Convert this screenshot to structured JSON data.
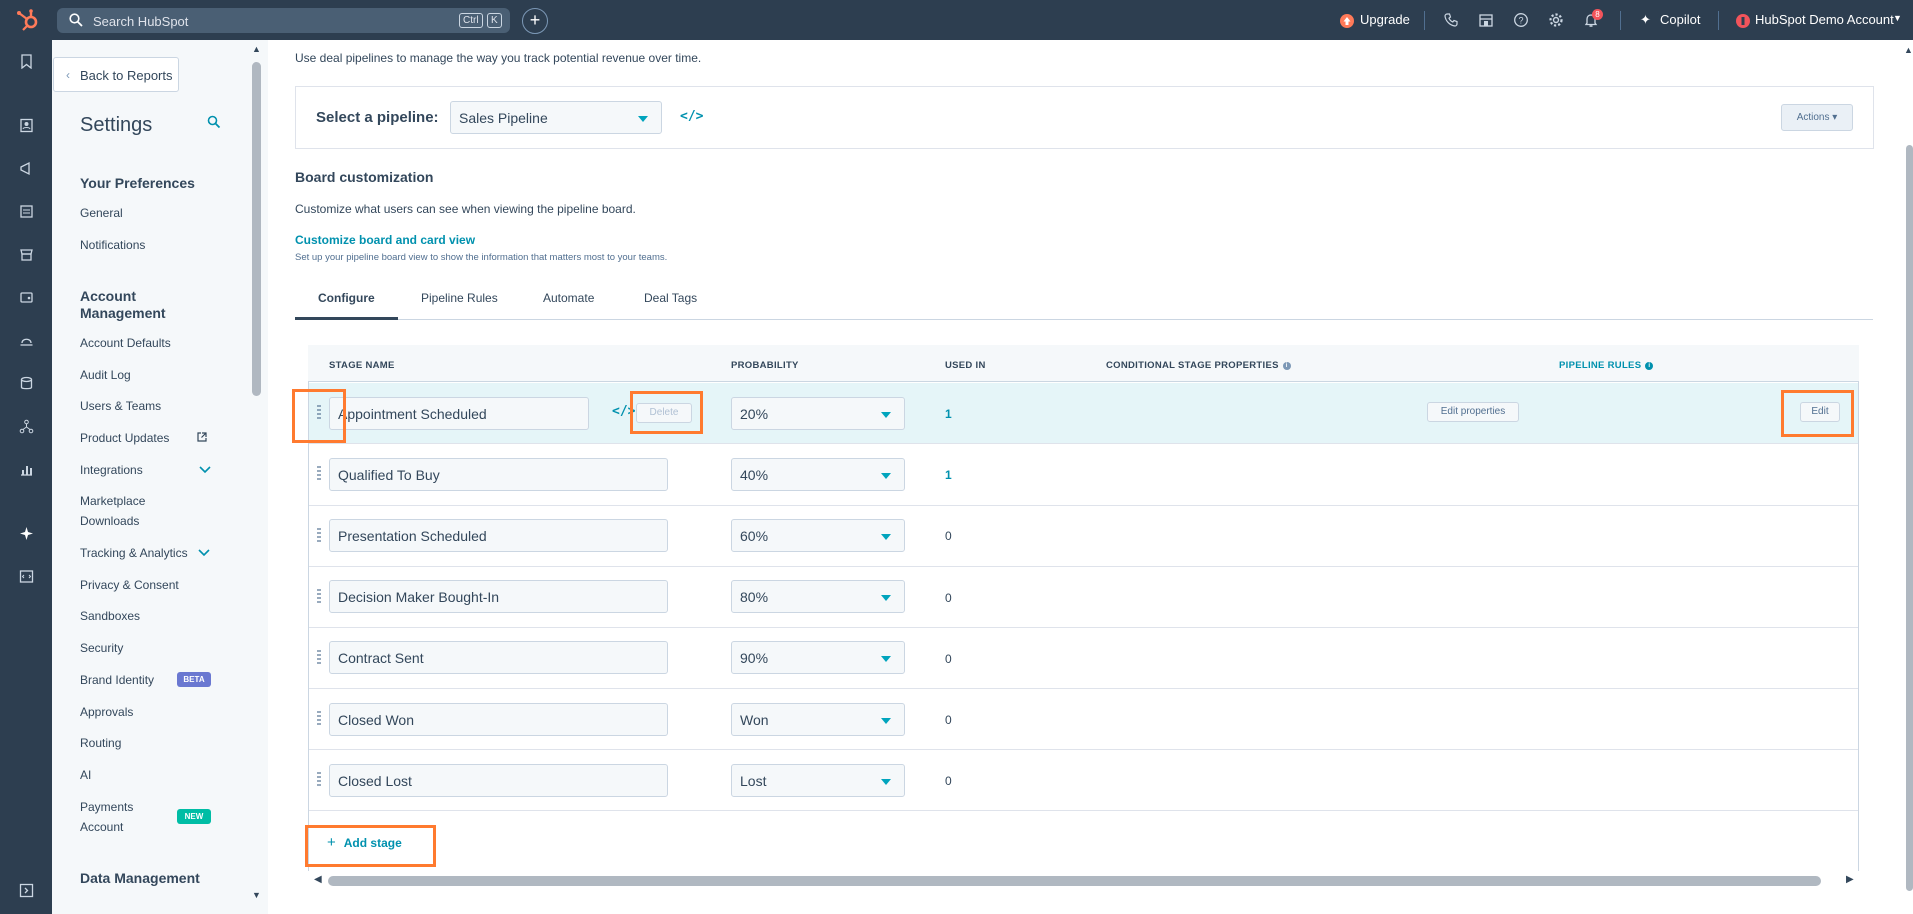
{
  "topbar": {
    "search_placeholder": "Search HubSpot",
    "shortcut_ctrl": "Ctrl",
    "shortcut_key": "K",
    "create_label": "+",
    "upgrade_label": "Upgrade",
    "copilot_label": "Copilot",
    "notification_count": "8",
    "account_name": "HubSpot Demo Account"
  },
  "sidebar": {
    "back_label": "Back to Reports",
    "title": "Settings",
    "section_preferences": "Your Preferences",
    "prefs": [
      "General",
      "Notifications"
    ],
    "section_account": "Account Management",
    "account_items": {
      "defaults": "Account Defaults",
      "audit": "Audit Log",
      "users": "Users & Teams",
      "updates": "Product Updates",
      "integrations": "Integrations",
      "marketplace": "Marketplace Downloads",
      "tracking": "Tracking & Analytics",
      "privacy": "Privacy & Consent",
      "sandboxes": "Sandboxes",
      "security": "Security",
      "brand": "Brand Identity",
      "brand_badge": "BETA",
      "approvals": "Approvals",
      "routing": "Routing",
      "ai": "AI",
      "payments": "Payments Account",
      "payments_badge": "NEW"
    },
    "section_data": "Data Management"
  },
  "main": {
    "description": "Use deal pipelines to manage the way you track potential revenue over time.",
    "pipeline_label": "Select a pipeline:",
    "pipeline_value": "Sales Pipeline",
    "actions_label": "Actions ▾",
    "board_title": "Board customization",
    "board_desc": "Customize what users can see when viewing the pipeline board.",
    "customize_link": "Customize board and card view",
    "customize_desc": "Set up your pipeline board view to show the information that matters most to your teams.",
    "tabs": [
      "Configure",
      "Pipeline Rules",
      "Automate",
      "Deal Tags"
    ]
  },
  "table": {
    "headers": {
      "stage_name": "STAGE NAME",
      "probability": "PROBABILITY",
      "used_in": "USED IN",
      "conditional": "CONDITIONAL STAGE PROPERTIES",
      "pipeline_rules": "PIPELINE RULES"
    },
    "rows": [
      {
        "name": "Appointment Scheduled",
        "probability": "20%",
        "used_in": "1"
      },
      {
        "name": "Qualified To Buy",
        "probability": "40%",
        "used_in": "1"
      },
      {
        "name": "Presentation Scheduled",
        "probability": "60%",
        "used_in": "0"
      },
      {
        "name": "Decision Maker Bought-In",
        "probability": "80%",
        "used_in": "0"
      },
      {
        "name": "Contract Sent",
        "probability": "90%",
        "used_in": "0"
      },
      {
        "name": "Closed Won",
        "probability": "Won",
        "used_in": "0"
      },
      {
        "name": "Closed Lost",
        "probability": "Lost",
        "used_in": "0"
      }
    ],
    "delete_label": "Delete",
    "edit_properties_label": "Edit properties",
    "edit_label": "Edit",
    "add_stage_label": "Add stage"
  }
}
